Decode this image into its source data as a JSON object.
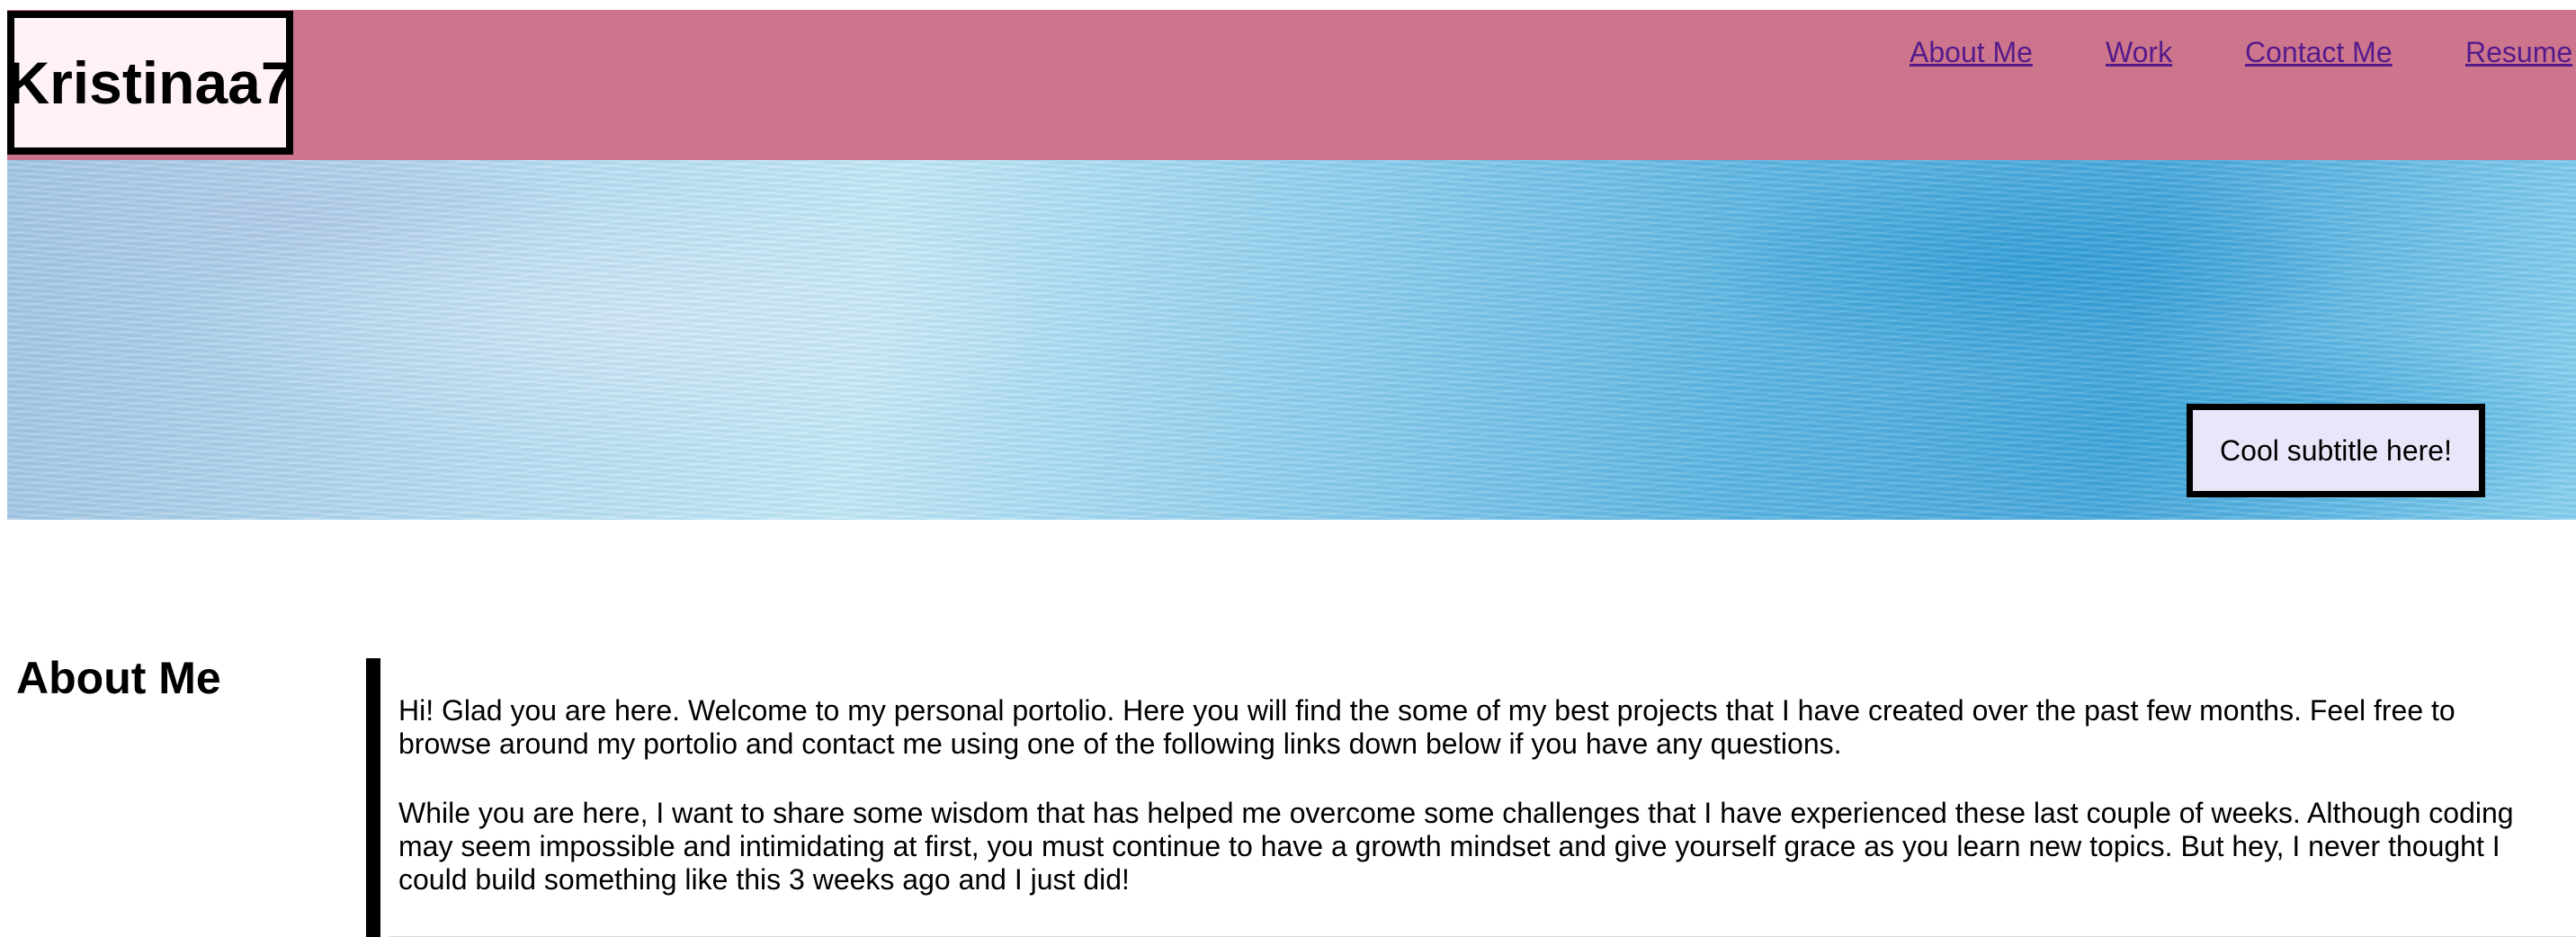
{
  "header": {
    "logo_text": "Kristinaa7",
    "nav": [
      "About Me",
      "Work",
      "Contact Me",
      "Resume"
    ]
  },
  "hero": {
    "subtitle": "Cool subtitle here!"
  },
  "about": {
    "heading": "About Me",
    "paragraphs": [
      "Hi! Glad you are here. Welcome to my personal portolio. Here you will find the some of my best projects that I have created over the past few months. Feel free to browse around my portolio and contact me using one of the following links down below if you have any questions.",
      "While you are here, I want to share some wisdom that has helped me overcome some challenges that I have experienced these last couple of weeks. Although coding may seem impossible and intimidating at first, you must continue to have a growth mindset and give yourself grace as you learn new topics. But hey, I never thought I could build something like this 3 weeks ago and I just did!"
    ]
  },
  "colors": {
    "header_bg": "#cd758d",
    "logo_bg": "#fff2f5",
    "link": "#551a8b",
    "subtitle_bg": "#e8e6f8"
  }
}
